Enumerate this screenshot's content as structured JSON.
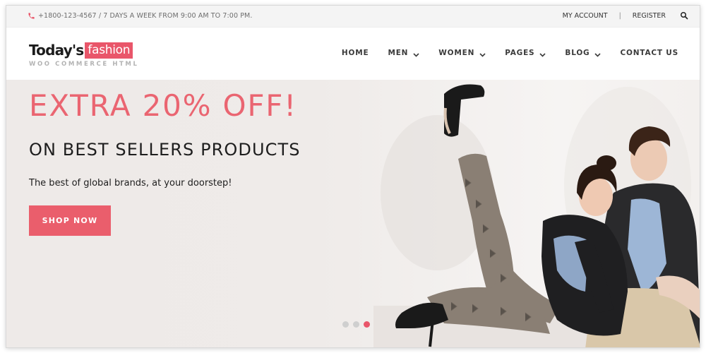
{
  "topbar": {
    "contact_text": "+1800-123-4567 / 7 DAYS A WEEK FROM 9:00 AM TO 7:00 PM.",
    "phone_icon": "phone-icon",
    "my_account": "MY ACCOUNT",
    "separator": "|",
    "register": "REGISTER",
    "search_icon": "search-icon"
  },
  "logo": {
    "today": "Today's",
    "fashion": "fashion",
    "subtitle": "WOO COMMERCE HTML"
  },
  "nav": {
    "items": [
      {
        "label": "HOME",
        "has_dropdown": false
      },
      {
        "label": "MEN",
        "has_dropdown": true
      },
      {
        "label": "WOMEN",
        "has_dropdown": true
      },
      {
        "label": "PAGES",
        "has_dropdown": true
      },
      {
        "label": "BLOG",
        "has_dropdown": true
      },
      {
        "label": "CONTACT US",
        "has_dropdown": false
      }
    ]
  },
  "hero": {
    "headline": "EXTRA 20% OFF!",
    "subheadline": "ON BEST SELLERS PRODUCTS",
    "tagline": "The best of global brands, at your doorstep!",
    "cta_label": "SHOP NOW",
    "slides_total": 3,
    "active_slide": 3
  },
  "colors": {
    "accent": "#e9566a",
    "headline": "#ea6571",
    "text_dark": "#1e1e1e",
    "topbar_bg": "#f4f4f4"
  }
}
